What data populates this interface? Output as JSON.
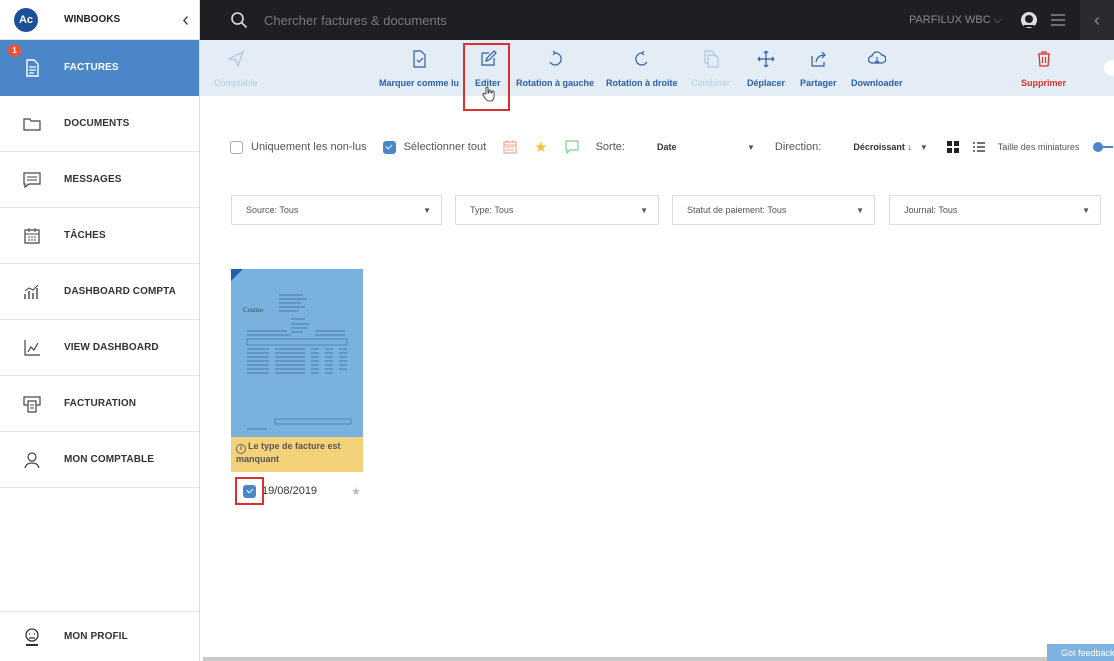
{
  "brand": {
    "logo_text": "Ac",
    "name": "WINBOOKS"
  },
  "sidebar": {
    "items": [
      {
        "label": "FACTURES",
        "badge": "1",
        "active": true
      },
      {
        "label": "DOCUMENTS"
      },
      {
        "label": "MESSAGES"
      },
      {
        "label": "TÂCHES"
      },
      {
        "label": "DASHBOARD COMPTA"
      },
      {
        "label": "VIEW DASHBOARD"
      },
      {
        "label": "FACTURATION"
      },
      {
        "label": "MON COMPTABLE"
      }
    ],
    "profile_label": "MON PROFIL"
  },
  "topbar": {
    "search_placeholder": "Chercher factures & documents",
    "account": "PARFILUX WBC",
    "account_caret": "⌵"
  },
  "toolbar": {
    "comptable": "Comptable",
    "marquer": "Marquer comme lu",
    "editer": "Editer",
    "rotation_gauche": "Rotation à gauche",
    "rotation_droite": "Rotation à droite",
    "combiner": "Combiner",
    "deplacer": "Déplacer",
    "partager": "Partager",
    "downloader": "Downloader",
    "supprimer": "Supprimer"
  },
  "options": {
    "unread_only": "Uniquement les non-lus",
    "select_all": "Sélectionner tout",
    "sort_label": "Sorte:",
    "sort_value": "Date",
    "direction_label": "Direction:",
    "direction_value": "Décroissant ↓",
    "thumb_size_label": "Taille des miniatures"
  },
  "filters": {
    "source": "Source: Tous",
    "type": "Type: Tous",
    "statut": "Statut de paiement: Tous",
    "journal": "Journal: Tous"
  },
  "card": {
    "warning": "Le type de facture est manquant",
    "date": "19/08/2019"
  },
  "feedback": "Got feedback",
  "colors": {
    "accent": "#4a86c8",
    "toolbar_bg": "#e4edf6",
    "topbar_bg": "#1e1f23",
    "danger": "#d9302c",
    "warning_bg": "#f3d27a",
    "badge": "#e8533a"
  }
}
